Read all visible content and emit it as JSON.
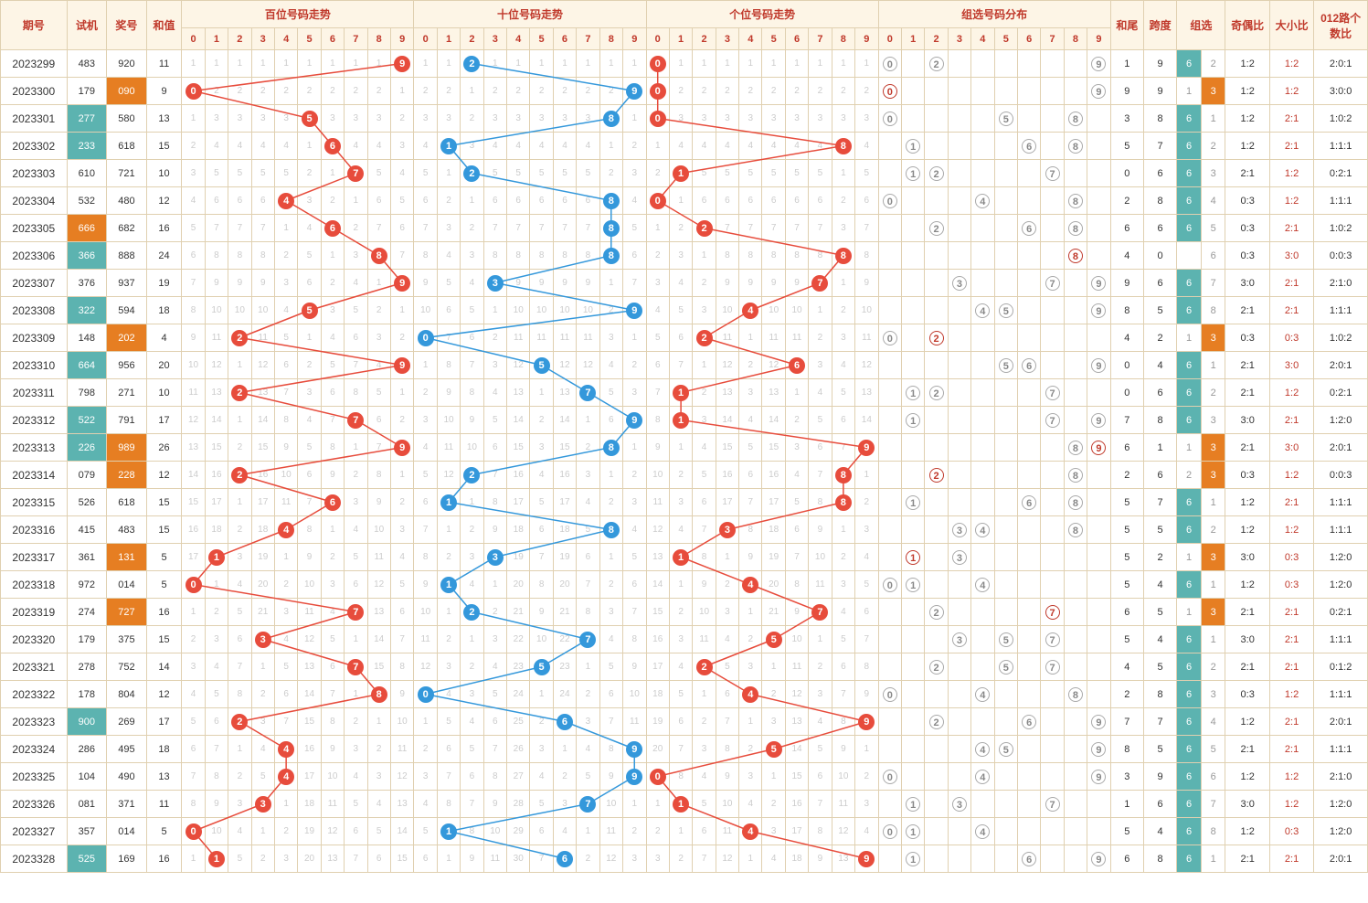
{
  "headers": {
    "period": "期号",
    "trial": "试机",
    "award": "奖号",
    "sum": "和值",
    "hundreds": "百位号码走势",
    "tens": "十位号码走势",
    "units": "个位号码走势",
    "dist": "组选号码分布",
    "tail": "和尾",
    "span": "跨度",
    "zu": "组选",
    "odd_even": "奇偶比",
    "big_small": "大小比",
    "r012": "012路个数比"
  },
  "chart_data": {
    "type": "table",
    "title": "3D Lottery Trend Chart",
    "columns": [
      "period",
      "trial",
      "award",
      "sum",
      "hundreds_digit",
      "tens_digit",
      "units_digit",
      "tail",
      "span",
      "zu",
      "odd_even",
      "big_small",
      "r012"
    ],
    "rows": [
      {
        "period": "2023299",
        "trial": "483",
        "trial_hl": "",
        "award": "920",
        "award_hl": "",
        "sum": 11,
        "h": 9,
        "t": 2,
        "u": 0,
        "tail": 1,
        "span": 9,
        "zu": "6",
        "zuN": 2,
        "oe": "1:2",
        "bs": "1:2",
        "bs_r": 1,
        "r012": "2:0:1"
      },
      {
        "period": "2023300",
        "trial": "179",
        "trial_hl": "",
        "award": "090",
        "award_hl": "or",
        "sum": 9,
        "h": 0,
        "t": 9,
        "u": 0,
        "tail": 9,
        "span": 9,
        "zu": "3",
        "zuN": 1,
        "oe": "1:2",
        "bs": "1:2",
        "bs_r": 1,
        "r012": "3:0:0"
      },
      {
        "period": "2023301",
        "trial": "277",
        "trial_hl": "hl",
        "award": "580",
        "award_hl": "",
        "sum": 13,
        "h": 5,
        "t": 8,
        "u": 0,
        "tail": 3,
        "span": 8,
        "zu": "6",
        "zuN": 1,
        "oe": "1:2",
        "bs": "2:1",
        "bs_r": 1,
        "r012": "1:0:2"
      },
      {
        "period": "2023302",
        "trial": "233",
        "trial_hl": "hl",
        "award": "618",
        "award_hl": "",
        "sum": 15,
        "h": 6,
        "t": 1,
        "u": 8,
        "tail": 5,
        "span": 7,
        "zu": "6",
        "zuN": 2,
        "oe": "1:2",
        "bs": "2:1",
        "bs_r": 1,
        "r012": "1:1:1"
      },
      {
        "period": "2023303",
        "trial": "610",
        "trial_hl": "",
        "award": "721",
        "award_hl": "",
        "sum": 10,
        "h": 7,
        "t": 2,
        "u": 1,
        "tail": 0,
        "span": 6,
        "zu": "6",
        "zuN": 3,
        "oe": "2:1",
        "bs": "1:2",
        "bs_r": 1,
        "r012": "0:2:1"
      },
      {
        "period": "2023304",
        "trial": "532",
        "trial_hl": "",
        "award": "480",
        "award_hl": "",
        "sum": 12,
        "h": 4,
        "t": 8,
        "u": 0,
        "tail": 2,
        "span": 8,
        "zu": "6",
        "zuN": 4,
        "oe": "0:3",
        "bs": "1:2",
        "bs_r": 1,
        "r012": "1:1:1"
      },
      {
        "period": "2023305",
        "trial": "666",
        "trial_hl": "rd",
        "award": "682",
        "award_hl": "",
        "sum": 16,
        "h": 6,
        "t": 8,
        "u": 2,
        "tail": 6,
        "span": 6,
        "zu": "6",
        "zuN": 5,
        "oe": "0:3",
        "bs": "2:1",
        "bs_r": 1,
        "r012": "1:0:2"
      },
      {
        "period": "2023306",
        "trial": "366",
        "trial_hl": "hl",
        "award": "888",
        "award_hl": "",
        "sum": 24,
        "h": 8,
        "t": 8,
        "u": 8,
        "tail": 4,
        "span": 0,
        "zu": "",
        "zuN": 6,
        "oe": "0:3",
        "bs": "3:0",
        "bs_r": 1,
        "r012": "0:0:3"
      },
      {
        "period": "2023307",
        "trial": "376",
        "trial_hl": "",
        "award": "937",
        "award_hl": "",
        "sum": 19,
        "h": 9,
        "t": 3,
        "u": 7,
        "tail": 9,
        "span": 6,
        "zu": "6",
        "zuN": 7,
        "oe": "3:0",
        "bs": "2:1",
        "bs_r": 1,
        "r012": "2:1:0"
      },
      {
        "period": "2023308",
        "trial": "322",
        "trial_hl": "hl",
        "award": "594",
        "award_hl": "",
        "sum": 18,
        "h": 5,
        "t": 9,
        "u": 4,
        "tail": 8,
        "span": 5,
        "zu": "6",
        "zuN": 8,
        "oe": "2:1",
        "bs": "2:1",
        "bs_r": 1,
        "r012": "1:1:1"
      },
      {
        "period": "2023309",
        "trial": "148",
        "trial_hl": "",
        "award": "202",
        "award_hl": "or",
        "sum": 4,
        "h": 2,
        "t": 0,
        "u": 2,
        "tail": 4,
        "span": 2,
        "zu": "3",
        "zuN": 1,
        "oe": "0:3",
        "bs": "0:3",
        "bs_r": 1,
        "r012": "1:0:2"
      },
      {
        "period": "2023310",
        "trial": "664",
        "trial_hl": "hl",
        "award": "956",
        "award_hl": "",
        "sum": 20,
        "h": 9,
        "t": 5,
        "u": 6,
        "tail": 0,
        "span": 4,
        "zu": "6",
        "zuN": 1,
        "oe": "2:1",
        "bs": "3:0",
        "bs_r": 1,
        "r012": "2:0:1"
      },
      {
        "period": "2023311",
        "trial": "798",
        "trial_hl": "",
        "award": "271",
        "award_hl": "",
        "sum": 10,
        "h": 2,
        "t": 7,
        "u": 1,
        "tail": 0,
        "span": 6,
        "zu": "6",
        "zuN": 2,
        "oe": "2:1",
        "bs": "1:2",
        "bs_r": 1,
        "r012": "0:2:1"
      },
      {
        "period": "2023312",
        "trial": "522",
        "trial_hl": "hl",
        "award": "791",
        "award_hl": "",
        "sum": 17,
        "h": 7,
        "t": 9,
        "u": 1,
        "tail": 7,
        "span": 8,
        "zu": "6",
        "zuN": 3,
        "oe": "3:0",
        "bs": "2:1",
        "bs_r": 1,
        "r012": "1:2:0"
      },
      {
        "period": "2023313",
        "trial": "226",
        "trial_hl": "hl",
        "award": "989",
        "award_hl": "or",
        "sum": 26,
        "h": 9,
        "t": 8,
        "u": 9,
        "tail": 6,
        "span": 1,
        "zu": "3",
        "zuN": 1,
        "oe": "2:1",
        "bs": "3:0",
        "bs_r": 1,
        "r012": "2:0:1"
      },
      {
        "period": "2023314",
        "trial": "079",
        "trial_hl": "",
        "award": "228",
        "award_hl": "or",
        "sum": 12,
        "h": 2,
        "t": 2,
        "u": 8,
        "tail": 2,
        "span": 6,
        "zu": "3",
        "zuN": 2,
        "oe": "0:3",
        "bs": "1:2",
        "bs_r": 1,
        "r012": "0:0:3"
      },
      {
        "period": "2023315",
        "trial": "526",
        "trial_hl": "",
        "award": "618",
        "award_hl": "",
        "sum": 15,
        "h": 6,
        "t": 1,
        "u": 8,
        "tail": 5,
        "span": 7,
        "zu": "6",
        "zuN": 1,
        "oe": "1:2",
        "bs": "2:1",
        "bs_r": 1,
        "r012": "1:1:1"
      },
      {
        "period": "2023316",
        "trial": "415",
        "trial_hl": "",
        "award": "483",
        "award_hl": "",
        "sum": 15,
        "h": 4,
        "t": 8,
        "u": 3,
        "tail": 5,
        "span": 5,
        "zu": "6",
        "zuN": 2,
        "oe": "1:2",
        "bs": "1:2",
        "bs_r": 1,
        "r012": "1:1:1"
      },
      {
        "period": "2023317",
        "trial": "361",
        "trial_hl": "",
        "award": "131",
        "award_hl": "or",
        "sum": 5,
        "h": 1,
        "t": 3,
        "u": 1,
        "tail": 5,
        "span": 2,
        "zu": "3",
        "zuN": 1,
        "oe": "3:0",
        "bs": "0:3",
        "bs_r": 1,
        "r012": "1:2:0"
      },
      {
        "period": "2023318",
        "trial": "972",
        "trial_hl": "",
        "award": "014",
        "award_hl": "",
        "sum": 5,
        "h": 0,
        "t": 1,
        "u": 4,
        "tail": 5,
        "span": 4,
        "zu": "6",
        "zuN": 1,
        "oe": "1:2",
        "bs": "0:3",
        "bs_r": 1,
        "r012": "1:2:0"
      },
      {
        "period": "2023319",
        "trial": "274",
        "trial_hl": "",
        "award": "727",
        "award_hl": "or",
        "sum": 16,
        "h": 7,
        "t": 2,
        "u": 7,
        "tail": 6,
        "span": 5,
        "zu": "3",
        "zuN": 1,
        "oe": "2:1",
        "bs": "2:1",
        "bs_r": 1,
        "r012": "0:2:1"
      },
      {
        "period": "2023320",
        "trial": "179",
        "trial_hl": "",
        "award": "375",
        "award_hl": "",
        "sum": 15,
        "h": 3,
        "t": 7,
        "u": 5,
        "tail": 5,
        "span": 4,
        "zu": "6",
        "zuN": 1,
        "oe": "3:0",
        "bs": "2:1",
        "bs_r": 1,
        "r012": "1:1:1"
      },
      {
        "period": "2023321",
        "trial": "278",
        "trial_hl": "",
        "award": "752",
        "award_hl": "",
        "sum": 14,
        "h": 7,
        "t": 5,
        "u": 2,
        "tail": 4,
        "span": 5,
        "zu": "6",
        "zuN": 2,
        "oe": "2:1",
        "bs": "2:1",
        "bs_r": 1,
        "r012": "0:1:2"
      },
      {
        "period": "2023322",
        "trial": "178",
        "trial_hl": "",
        "award": "804",
        "award_hl": "",
        "sum": 12,
        "h": 8,
        "t": 0,
        "u": 4,
        "tail": 2,
        "span": 8,
        "zu": "6",
        "zuN": 3,
        "oe": "0:3",
        "bs": "1:2",
        "bs_r": 1,
        "r012": "1:1:1"
      },
      {
        "period": "2023323",
        "trial": "900",
        "trial_hl": "hl",
        "award": "269",
        "award_hl": "",
        "sum": 17,
        "h": 2,
        "t": 6,
        "u": 9,
        "tail": 7,
        "span": 7,
        "zu": "6",
        "zuN": 4,
        "oe": "1:2",
        "bs": "2:1",
        "bs_r": 1,
        "r012": "2:0:1"
      },
      {
        "period": "2023324",
        "trial": "286",
        "trial_hl": "",
        "award": "495",
        "award_hl": "",
        "sum": 18,
        "h": 4,
        "t": 9,
        "u": 5,
        "tail": 8,
        "span": 5,
        "zu": "6",
        "zuN": 5,
        "oe": "2:1",
        "bs": "2:1",
        "bs_r": 1,
        "r012": "1:1:1"
      },
      {
        "period": "2023325",
        "trial": "104",
        "trial_hl": "",
        "award": "490",
        "award_hl": "",
        "sum": 13,
        "h": 4,
        "t": 9,
        "u": 0,
        "tail": 3,
        "span": 9,
        "zu": "6",
        "zuN": 6,
        "oe": "1:2",
        "bs": "1:2",
        "bs_r": 1,
        "r012": "2:1:0"
      },
      {
        "period": "2023326",
        "trial": "081",
        "trial_hl": "",
        "award": "371",
        "award_hl": "",
        "sum": 11,
        "h": 3,
        "t": 7,
        "u": 1,
        "tail": 1,
        "span": 6,
        "zu": "6",
        "zuN": 7,
        "oe": "3:0",
        "bs": "1:2",
        "bs_r": 1,
        "r012": "1:2:0"
      },
      {
        "period": "2023327",
        "trial": "357",
        "trial_hl": "",
        "award": "014",
        "award_hl": "",
        "sum": 5,
        "h": 0,
        "t": 1,
        "u": 4,
        "tail": 5,
        "span": 4,
        "zu": "6",
        "zuN": 8,
        "oe": "1:2",
        "bs": "0:3",
        "bs_r": 1,
        "r012": "1:2:0"
      },
      {
        "period": "2023328",
        "trial": "525",
        "trial_hl": "hl",
        "award": "169",
        "award_hl": "",
        "sum": 16,
        "h": 1,
        "t": 6,
        "u": 9,
        "tail": 6,
        "span": 8,
        "zu": "6",
        "zuN": 1,
        "oe": "2:1",
        "bs": "2:1",
        "bs_r": 1,
        "r012": "2:0:1"
      }
    ]
  }
}
